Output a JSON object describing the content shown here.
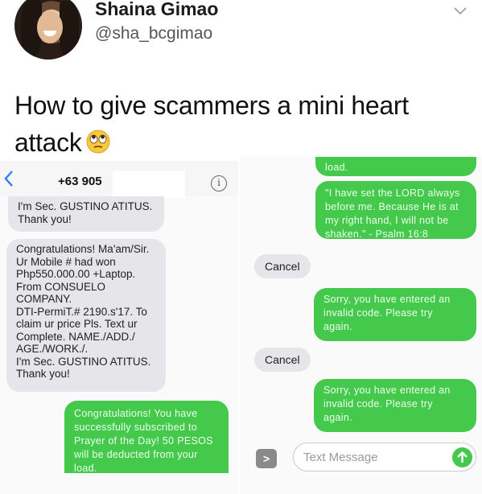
{
  "tweet": {
    "display_name": "Shaina Gimao",
    "handle": "@sha_bcgimao",
    "text": "How to give scammers a mini heart attack",
    "emoji": "face-with-rolling-eyes"
  },
  "left_screenshot": {
    "phone_number": "+63 905",
    "messages": [
      {
        "from": "sender",
        "text": "I'm Sec. GUSTINO ATITUS.\nThank you!"
      },
      {
        "from": "sender",
        "text": "Congratulations! Ma'am/Sir.\nUr Mobile # had won\nPhp550.000.00 +Laptop.\nFrom CONSUELO\nCOMPANY.\nDTI-PermiT.# 2190.s'17. To\nclaim ur price Pls. Text ur\nComplete. NAME./ADD./\nAGE./WORK./.\nI'm Sec. GUSTINO ATITUS.\nThank you!"
      },
      {
        "from": "me",
        "text": "Congratulations! You have\nsuccessfully subscribed to\nPrayer of the Day! 50 PESOS\nwill be deducted from your\nload."
      }
    ]
  },
  "right_screenshot": {
    "messages": [
      {
        "from": "me",
        "text": "load."
      },
      {
        "from": "me",
        "text": "\"I have set the LORD always\nbefore me. Because He is at\nmy right hand, I will not be\nshaken.\" - Psalm 16:8"
      },
      {
        "from": "sender",
        "text": "Cancel"
      },
      {
        "from": "me",
        "text": "Sorry, you have entered an\ninvalid code. Please try\nagain."
      },
      {
        "from": "sender",
        "text": "Cancel"
      },
      {
        "from": "me",
        "text": "Sorry, you have entered an\ninvalid code. Please try\nagain."
      }
    ],
    "input_placeholder": "Text Message"
  },
  "colors": {
    "imessage_green": "#45c94d",
    "received_gray": "#e5e5ea",
    "ios_blue": "#2f7cf6"
  }
}
